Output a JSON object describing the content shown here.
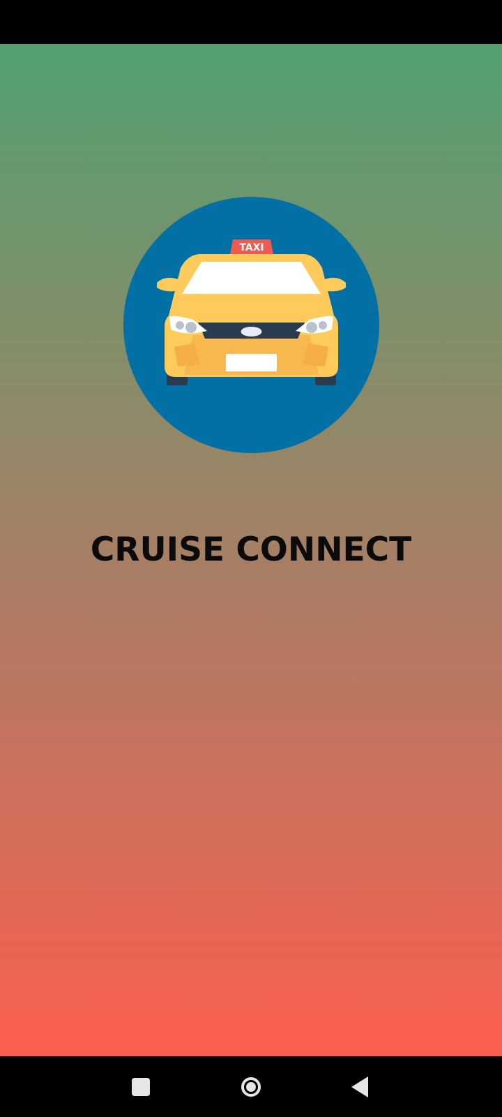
{
  "app": {
    "title": "CRUISE CONNECT"
  },
  "logo": {
    "icon": "taxi-icon",
    "sign_text": "TAXI"
  },
  "colors": {
    "gradient_top": "#52a073",
    "gradient_bottom": "#fd5e4f",
    "logo_circle": "#0270a4",
    "taxi_body": "#fdca5c",
    "title_text": "#0b0b0b"
  },
  "nav": {
    "recent_icon": "square-icon",
    "home_icon": "circle-icon",
    "back_icon": "triangle-back-icon"
  }
}
